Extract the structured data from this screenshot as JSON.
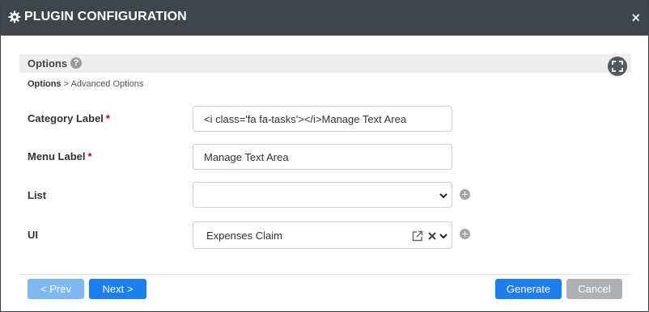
{
  "dialog": {
    "title": "PLUGIN CONFIGURATION",
    "close_symbol": "×"
  },
  "options": {
    "heading": "Options",
    "help_symbol": "?"
  },
  "breadcrumb": {
    "current": "Options",
    "separator": " > ",
    "next": "Advanced Options"
  },
  "form": {
    "category_label": {
      "label": "Category Label",
      "required": "*",
      "value": "<i class='fa fa-tasks'></i>Manage Text Area"
    },
    "menu_label": {
      "label": "Menu Label",
      "required": "*",
      "value": "Manage Text Area"
    },
    "list": {
      "label": "List",
      "value": ""
    },
    "ui": {
      "label": "UI",
      "value": "Expenses Claim"
    }
  },
  "buttons": {
    "prev": "< Prev",
    "next": "Next >",
    "generate": "Generate",
    "cancel": "Cancel"
  },
  "colors": {
    "titlebar": "#3e464d",
    "primary": "#1b7ff0",
    "primary_disabled": "#7db8f5",
    "cancel": "#aeb1b4",
    "required": "#d00000"
  },
  "icons": {
    "title": "gear-icon",
    "close": "close-icon",
    "help": "question-circle-icon",
    "fullscreen": "expand-icon",
    "select": "chevron-down-icon",
    "add": "plus-circle-icon",
    "edit": "external-edit-icon",
    "clear": "clear-x-icon"
  }
}
